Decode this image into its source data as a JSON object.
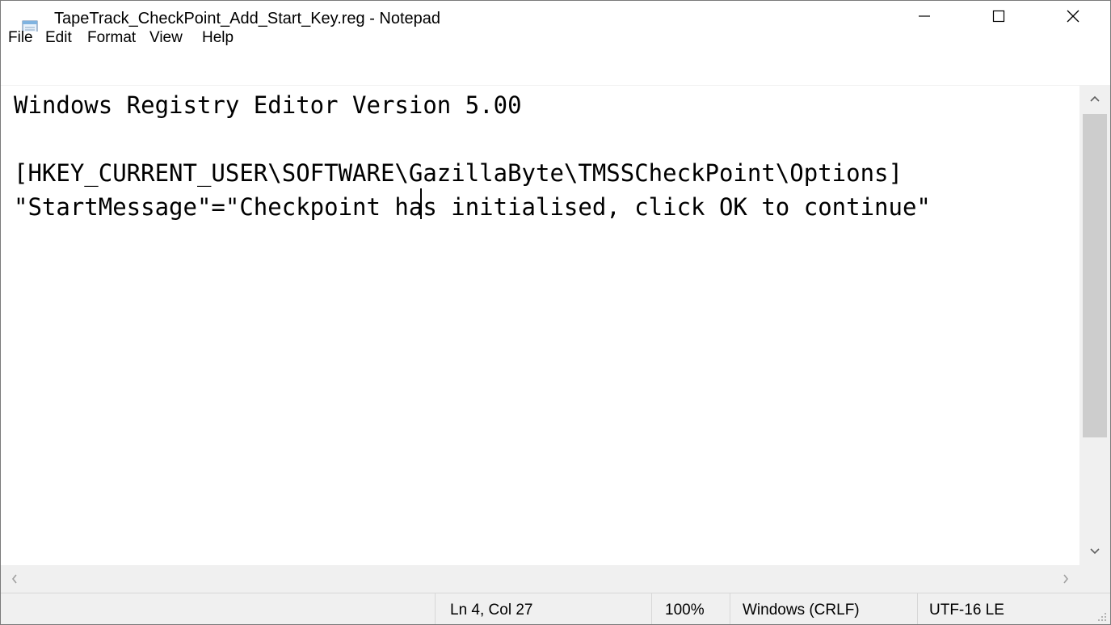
{
  "window": {
    "title": "TapeTrack_CheckPoint_Add_Start_Key.reg - Notepad",
    "app_icon": "notepad-icon",
    "controls": [
      "minimize-icon",
      "maximize-icon",
      "close-icon"
    ]
  },
  "menu": {
    "file": "File",
    "edit": "Edit",
    "format": "Format",
    "view": "View",
    "help": "Help"
  },
  "editor": {
    "lines": [
      "Windows Registry Editor Version 5.00",
      "",
      "[HKEY_CURRENT_USER\\SOFTWARE\\GazillaByte\\TMSSCheckPoint\\Options]",
      "\"StartMessage\"=\"Checkpoint has initialised, click OK to continue\""
    ]
  },
  "status": {
    "position": "Ln 4, Col 27",
    "zoom": "100%",
    "line_ending": "Windows (CRLF)",
    "encoding": "UTF-16 LE"
  },
  "colors": {
    "chrome": "#f0f0f0",
    "scroll_thumb": "#cdcdcd",
    "border": "#d7d7d7"
  }
}
